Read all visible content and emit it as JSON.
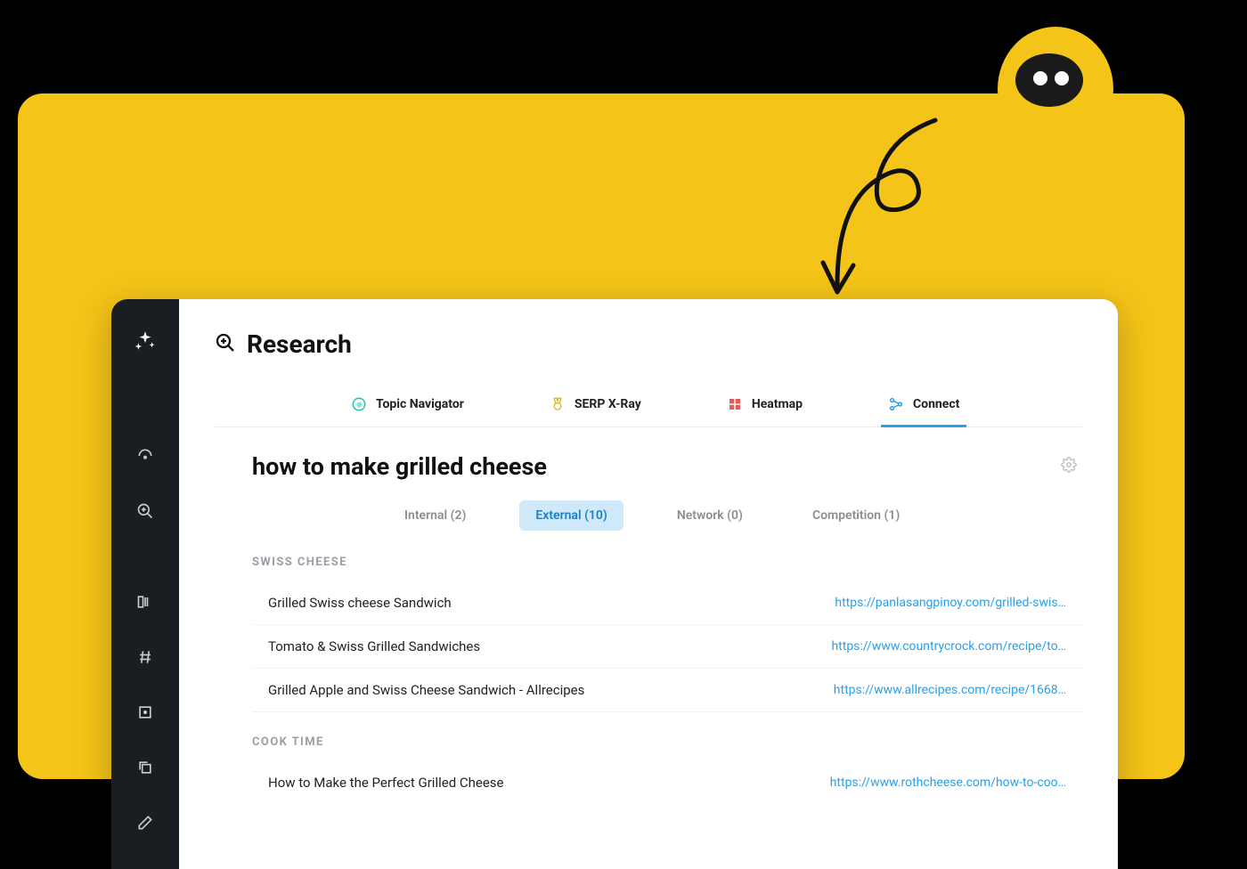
{
  "colors": {
    "accent_yellow": "#F5C418",
    "accent_blue": "#2B9FE8",
    "sidebar_bg": "#1a1d21",
    "link_blue": "#2B9FE8"
  },
  "page": {
    "title": "Research"
  },
  "main_tabs": [
    {
      "label": "Topic Navigator",
      "icon": "compass-icon",
      "active": false
    },
    {
      "label": "SERP X-Ray",
      "icon": "medal-icon",
      "active": false
    },
    {
      "label": "Heatmap",
      "icon": "grid-icon",
      "active": false
    },
    {
      "label": "Connect",
      "icon": "connect-icon",
      "active": true
    }
  ],
  "query": "how to make grilled cheese",
  "sub_tabs": [
    {
      "label": "Internal (2)",
      "active": false
    },
    {
      "label": "External (10)",
      "active": true
    },
    {
      "label": "Network (0)",
      "active": false
    },
    {
      "label": "Competition (1)",
      "active": false
    }
  ],
  "groups": [
    {
      "header": "SWISS CHEESE",
      "rows": [
        {
          "title": "Grilled Swiss cheese Sandwich",
          "url": "https://panlasangpinoy.com/grilled-swis…"
        },
        {
          "title": "Tomato & Swiss Grilled Sandwiches",
          "url": "https://www.countrycrock.com/recipe/to…"
        },
        {
          "title": "Grilled Apple and Swiss Cheese Sandwich - Allrecipes",
          "url": "https://www.allrecipes.com/recipe/1668…"
        }
      ]
    },
    {
      "header": "COOK TIME",
      "rows": [
        {
          "title": "How to Make the Perfect Grilled Cheese",
          "url": "https://www.rothcheese.com/how-to-coo…"
        }
      ]
    }
  ]
}
